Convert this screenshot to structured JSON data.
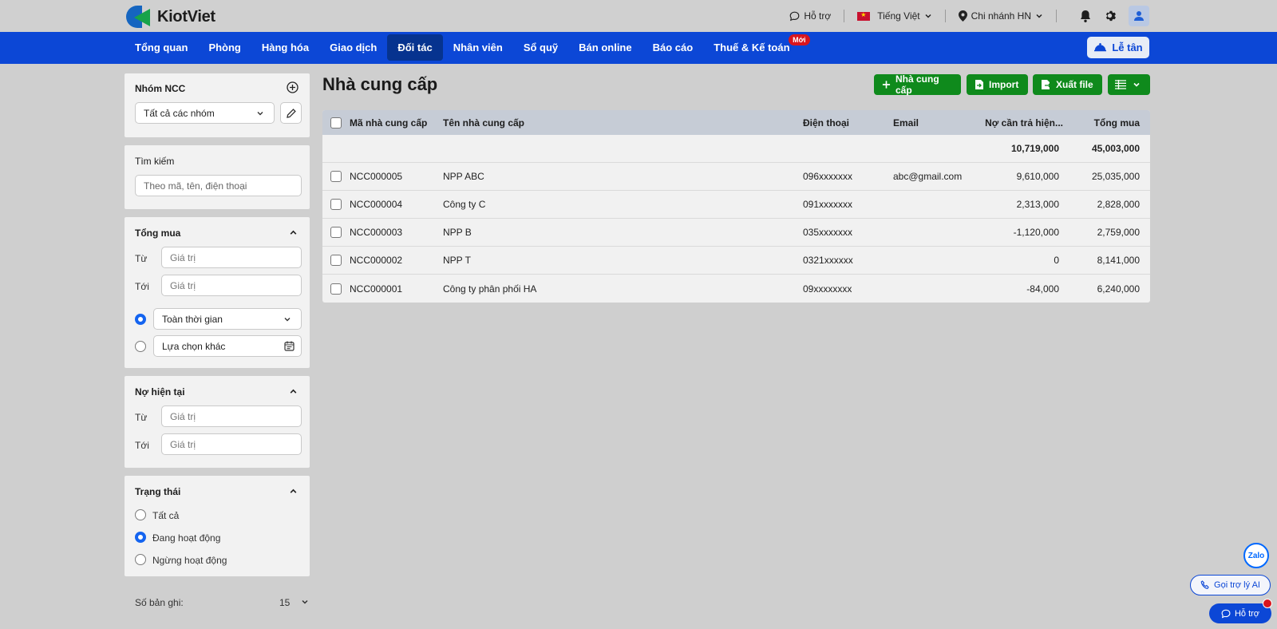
{
  "brand": {
    "name": "KiotViet"
  },
  "topbar": {
    "help": "Hỗ trợ",
    "language": "Tiếng Việt",
    "branch": "Chi nhánh HN"
  },
  "nav": {
    "items": [
      "Tổng quan",
      "Phòng",
      "Hàng hóa",
      "Giao dịch",
      "Đối tác",
      "Nhân viên",
      "Sổ quỹ",
      "Bán online",
      "Báo cáo",
      "Thuế & Kế toán"
    ],
    "active_index": 4,
    "new_badge": "Mới",
    "reception": "Lễ tân"
  },
  "sidebar": {
    "group": {
      "title": "Nhóm NCC",
      "select_value": "Tất cả các nhóm"
    },
    "search": {
      "title": "Tìm kiếm",
      "placeholder": "Theo mã, tên, điện thoại"
    },
    "total_purchase": {
      "title": "Tổng mua",
      "from_label": "Từ",
      "to_label": "Tới",
      "placeholder": "Giá trị",
      "time_option": "Toàn thời gian",
      "custom_option": "Lựa chọn khác"
    },
    "debt": {
      "title": "Nợ hiện tại",
      "from_label": "Từ",
      "to_label": "Tới",
      "placeholder": "Giá trị"
    },
    "status": {
      "title": "Trạng thái",
      "options": [
        "Tất cả",
        "Đang hoạt động",
        "Ngừng hoạt động"
      ],
      "selected_index": 1
    },
    "records_label": "Số bản ghi:",
    "records_value": "15"
  },
  "main": {
    "title": "Nhà cung cấp",
    "buttons": {
      "add": "Nhà cung cấp",
      "import": "Import",
      "export": "Xuất file"
    },
    "columns": [
      "Mã nhà cung cấp",
      "Tên nhà cung cấp",
      "Điện thoại",
      "Email",
      "Nợ cần trả hiện...",
      "Tổng mua"
    ],
    "summary": {
      "debt": "10,719,000",
      "total": "45,003,000"
    },
    "rows": [
      {
        "code": "NCC000005",
        "name": "NPP ABC",
        "phone": "096xxxxxxx",
        "email": "abc@gmail.com",
        "debt": "9,610,000",
        "total": "25,035,000"
      },
      {
        "code": "NCC000004",
        "name": "Công ty C",
        "phone": "091xxxxxxx",
        "email": "",
        "debt": "2,313,000",
        "total": "2,828,000"
      },
      {
        "code": "NCC000003",
        "name": "NPP B",
        "phone": "035xxxxxxx",
        "email": "",
        "debt": "-1,120,000",
        "total": "2,759,000"
      },
      {
        "code": "NCC000002",
        "name": "NPP T",
        "phone": "0321xxxxxx",
        "email": "",
        "debt": "0",
        "total": "8,141,000"
      },
      {
        "code": "NCC000001",
        "name": "Công ty phân phối HA",
        "phone": "09xxxxxxxx",
        "email": "",
        "debt": "-84,000",
        "total": "6,240,000"
      }
    ]
  },
  "floating": {
    "zalo": "Zalo",
    "ai": "Gọi trợ lý AI",
    "help": "Hỗ trợ"
  },
  "colors": {
    "nav_bg": "#0c47d6",
    "nav_active": "#06338f",
    "primary_green": "#0f8a1c",
    "badge_red": "#d9151d"
  }
}
